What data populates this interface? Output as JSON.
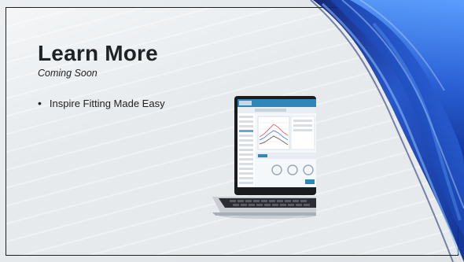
{
  "slide": {
    "title": "Learn More",
    "subtitle": "Coming Soon",
    "bullets": [
      "Inspire Fitting Made Easy"
    ]
  },
  "colors": {
    "accent_blue": "#1d4fc7",
    "deep_blue": "#0b1e74",
    "text": "#1f2328",
    "background": "#e6eaed"
  },
  "icons": {
    "bullet": "bullet-dot-icon",
    "laptop": "laptop-image",
    "ribbon": "blue-ribbon-decoration"
  }
}
